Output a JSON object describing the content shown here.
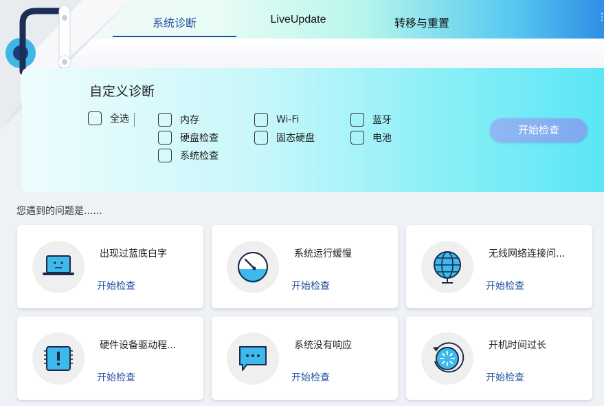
{
  "tabs": [
    {
      "label": "系统诊断",
      "active": true
    },
    {
      "label": "LiveUpdate",
      "active": false
    },
    {
      "label": "转移与重置",
      "active": false
    }
  ],
  "menu_icon": "more-vertical-icon",
  "custom": {
    "title": "自定义诊断",
    "select_all": "全选",
    "options": [
      "内存",
      "Wi-Fi",
      "蓝牙",
      "硬盘检查",
      "固态硬盘",
      "电池",
      "系统检查"
    ],
    "start_button": "开始检查"
  },
  "problems": {
    "heading": "您遇到的问题是......",
    "cards": [
      {
        "title": "出现过蓝底白字",
        "link": "开始检查",
        "icon": "laptop-sad-icon"
      },
      {
        "title": "系统运行缓慢",
        "link": "开始检查",
        "icon": "speedometer-icon"
      },
      {
        "title": "无线网络连接问...",
        "link": "开始检查",
        "icon": "globe-icon"
      },
      {
        "title": "硬件设备驱动程...",
        "link": "开始检查",
        "icon": "chip-alert-icon"
      },
      {
        "title": "系统没有响应",
        "link": "开始检查",
        "icon": "chat-dots-icon"
      },
      {
        "title": "开机时间过长",
        "link": "开始检查",
        "icon": "loading-clock-icon"
      }
    ]
  },
  "colors": {
    "accent": "#1f4f9e",
    "icon_blue": "#3db9ec",
    "button": "#84aef1"
  }
}
